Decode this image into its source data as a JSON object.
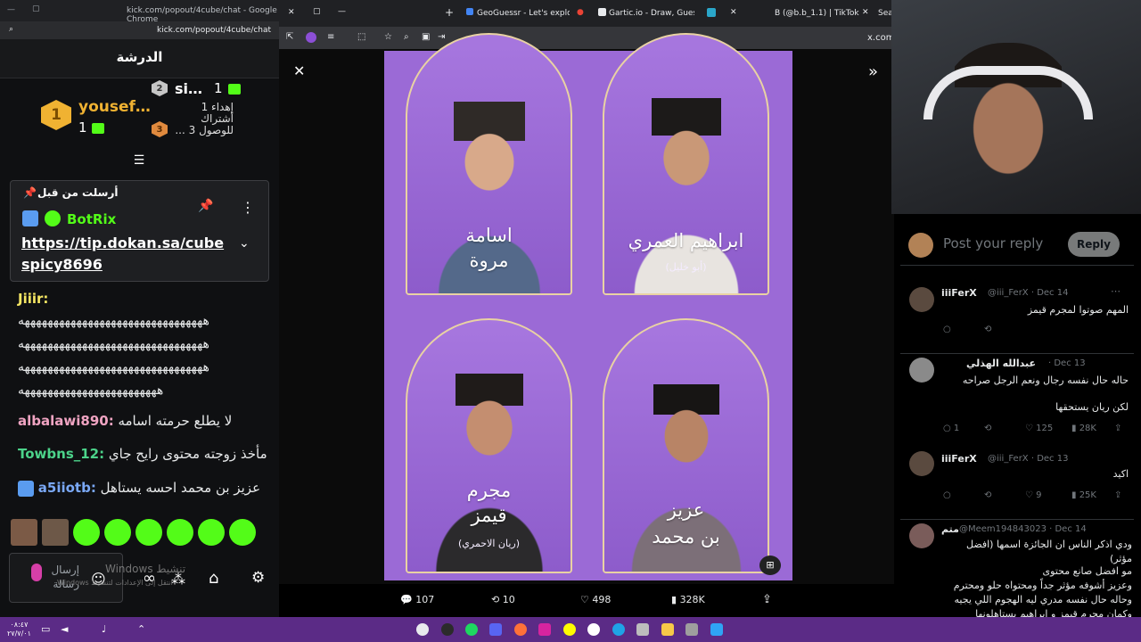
{
  "left_browser": {
    "url_title": "kick.com/popout/4cube/chat - Google Chrome",
    "url": "kick.com/popout/4cube/chat",
    "chat_title": "الدرشة"
  },
  "leaderboard": {
    "first": {
      "rank": "1",
      "name": "yousef…",
      "count": "1"
    },
    "second": {
      "rank": "2",
      "name": "si…",
      "count": "1"
    },
    "third": {
      "rank": "3",
      "text": "إهداء 1 أشتراك للوصول 3 ..."
    }
  },
  "pinned": {
    "header": "أرسلت من قبل",
    "user": "BotRix",
    "link": "https://tip.dokan.sa/cubespicy8696"
  },
  "chat": [
    {
      "user": "Jiiir:",
      "color": "#f5e663",
      "text": ""
    },
    {
      "user": "",
      "color": "#e7e9ea",
      "text": "ههههههههههههههههههههههههههههههههه"
    },
    {
      "user": "",
      "color": "#e7e9ea",
      "text": "ههههههههههههههههههههههههههههههههه"
    },
    {
      "user": "",
      "color": "#e7e9ea",
      "text": "ههههههههههههههههههههههههههههههههه"
    },
    {
      "user": "",
      "color": "#e7e9ea",
      "text": "ههههههههههههههههههههههههه"
    },
    {
      "user": "albalawi890:",
      "color": "#f0a4c2",
      "text": "لا يطلع حرمته اسامه"
    },
    {
      "user": "Towbns_12:",
      "color": "#4cd38a",
      "text": "مأخذ زوجته محتوى رايح جاي"
    },
    {
      "user": "a5iiotb:",
      "color": "#7aa8f5",
      "text": "عزيز بن محمد احسه يستاهل"
    }
  ],
  "chat_input_placeholder": "إرسال رسالة",
  "windows_watermark": "Windows تنشيط",
  "windows_watermark_sub": "Windows انتقل إلى الإعدادات لتنشيط",
  "tabs": [
    {
      "label": "GeoGuessr - Let's explore the w"
    },
    {
      "label": "Gartic.io - Draw, Guess, WIN"
    },
    {
      "label": "B (@b.b_1.1) | TikTok"
    },
    {
      "label": "Sea"
    }
  ],
  "address": "x.com/i",
  "poster": {
    "p1_line1": "اسامة",
    "p1_line2": "مروة",
    "p2_line1": "ابراهيم العمري",
    "p2_sub": "(أبو خليل)",
    "p3_line1": "مجرم",
    "p3_line2": "قيمز",
    "p3_sub": "(ريان الاحمري)",
    "p4_line1": "عزيز",
    "p4_line2": "بن محمد"
  },
  "actions": {
    "replies": "107",
    "reposts": "10",
    "likes": "498",
    "views": "328K"
  },
  "reply_box": {
    "placeholder": "Post your reply",
    "button": "Reply"
  },
  "tweets": [
    {
      "name": "iiiFerX",
      "handle": "@iii_FerX · Dec 14",
      "text": "المهم صوتوا لمجرم قيمز",
      "replies": "",
      "reposts": "",
      "likes": "",
      "views": ""
    },
    {
      "name": "عبدالله الهذلي",
      "handle": "· Dec 13",
      "text": "حاله حال نفسه رجال ونعم الرجل صراحه",
      "text2": "لكن ريان يستحقها",
      "replies": "1",
      "reposts": "",
      "likes": "125",
      "views": "28K"
    },
    {
      "name": "iiiFerX",
      "handle": "@iii_FerX · Dec 13",
      "text": "اكيد",
      "replies": "",
      "reposts": "",
      "likes": "9",
      "views": "25K"
    },
    {
      "name": "متم",
      "handle": "@Meem194843023 · Dec 14",
      "text": "ودي اذكر الناس ان الجائزة اسمها (افضل مؤثر)",
      "text2": "مو افضل صانع محتوى",
      "text3": "وعزيز أشوفه مؤثر جداً ومحتواه حلو ومحترم",
      "text4": "وحاله حال نفسه مدري ليه الهجوم اللي يجيه",
      "text5": "وكمان مجرم قيمز و ابراهيم يستاهلونها"
    }
  ],
  "clock": {
    "time": "٠٨:٤٧",
    "date": "٢٧/٧/٠١"
  },
  "colors": {
    "kick_green": "#53fc18",
    "poster_purple": "#9b6ad6",
    "taskbar": "#5b2b86"
  }
}
